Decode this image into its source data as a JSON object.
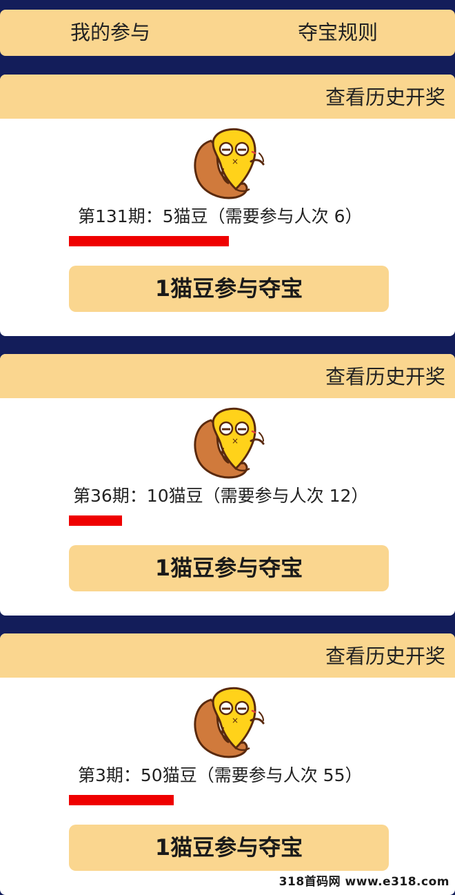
{
  "nav": {
    "my_participation": "我的参与",
    "rules": "夺宝规则"
  },
  "cards": [
    {
      "history_link": "查看历史开奖",
      "period_text": "第131期：5猫豆（需要参与人次 6）",
      "progress_fraction": 0.5,
      "button_label": "1猫豆参与夺宝"
    },
    {
      "history_link": "查看历史开奖",
      "period_text": "第36期：10猫豆（需要参与人次 12）",
      "progress_fraction": 0.17,
      "button_label": "1猫豆参与夺宝"
    },
    {
      "history_link": "查看历史开奖",
      "period_text": "第3期：50猫豆（需要参与人次 55）",
      "progress_fraction": 0.33,
      "button_label": "1猫豆参与夺宝"
    }
  ],
  "watermark": "318首码网 www.e318.com",
  "colors": {
    "background": "#131d5a",
    "accent": "#fad68f",
    "progress": "#ef0000"
  }
}
